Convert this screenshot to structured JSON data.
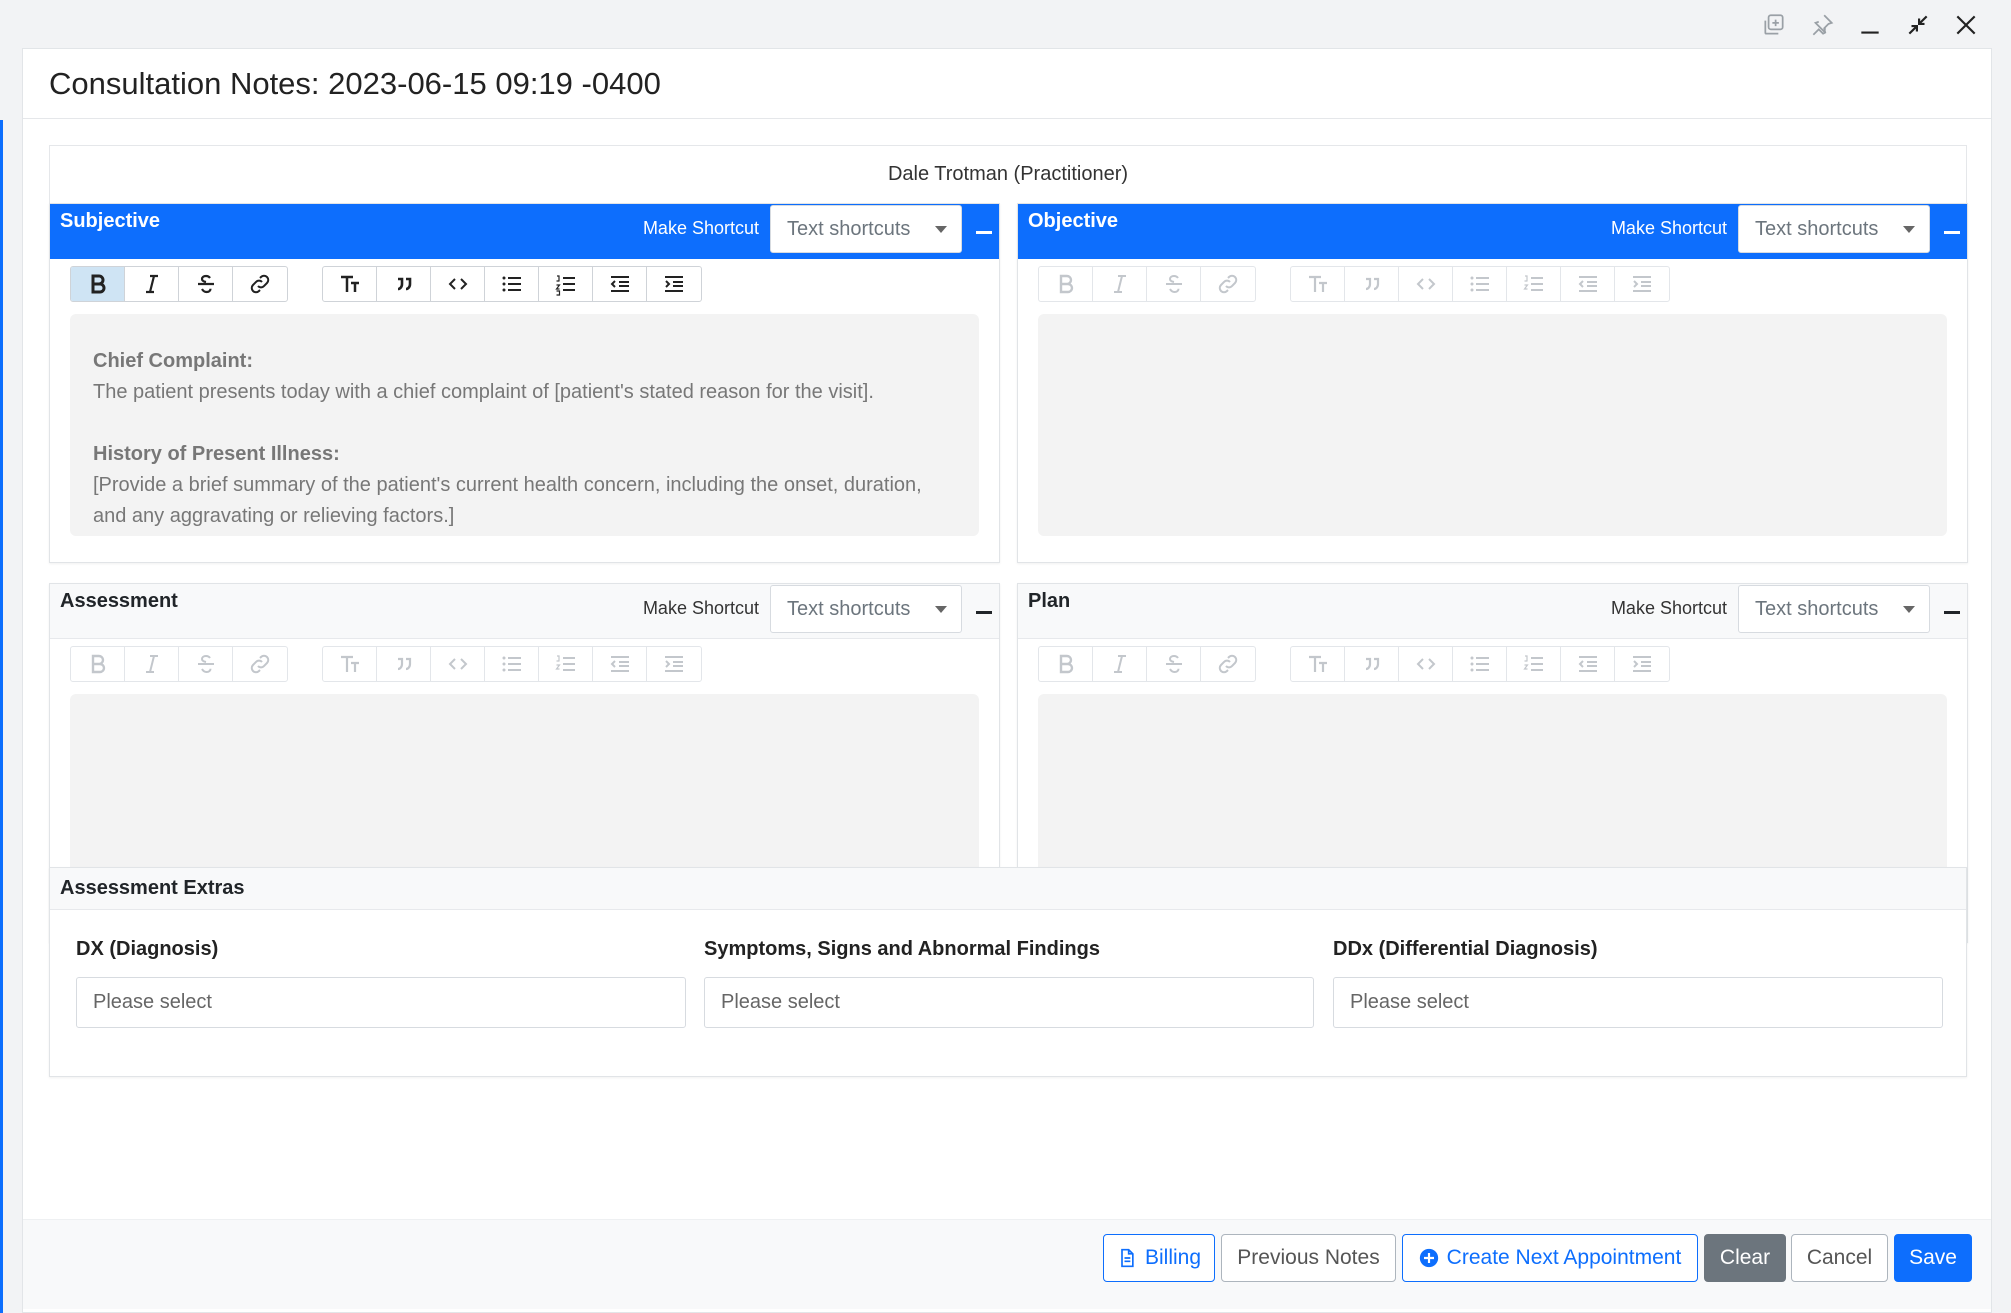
{
  "window_controls": [
    "restore-icon",
    "pin-icon",
    "minimize-icon",
    "collapse-icon",
    "close-icon"
  ],
  "modal": {
    "title": "Consultation Notes: 2023-06-15 09:19 -0400",
    "practitioner": "Dale Trotman (Practitioner)"
  },
  "panels": {
    "subjective": {
      "title": "Subjective",
      "make_shortcut": "Make Shortcut",
      "shortcut_placeholder": "Text shortcuts",
      "content": {
        "chief_complaint_heading": "Chief Complaint:",
        "chief_complaint_text": "The patient presents today with a chief complaint of [patient's stated reason for the visit].",
        "hpi_heading": "History of Present Illness:",
        "hpi_text": "[Provide a brief summary of the patient's current health concern, including the onset, duration, and any aggravating or relieving factors.]"
      }
    },
    "objective": {
      "title": "Objective",
      "make_shortcut": "Make Shortcut",
      "shortcut_placeholder": "Text shortcuts"
    },
    "assessment": {
      "title": "Assessment",
      "make_shortcut": "Make Shortcut",
      "shortcut_placeholder": "Text shortcuts"
    },
    "plan": {
      "title": "Plan",
      "make_shortcut": "Make Shortcut",
      "shortcut_placeholder": "Text shortcuts"
    }
  },
  "toolbar_icons": [
    "bold-icon",
    "italic-icon",
    "strikethrough-icon",
    "link-icon",
    "heading-icon",
    "quote-icon",
    "code-icon",
    "bullet-list-icon",
    "numbered-list-icon",
    "outdent-icon",
    "indent-icon"
  ],
  "extras": {
    "title": "Assessment Extras",
    "dx_label": "DX (Diagnosis)",
    "dx_placeholder": "Please select",
    "symptoms_label": "Symptoms, Signs and Abnormal Findings",
    "symptoms_placeholder": "Please select",
    "ddx_label": "DDx (Differential Diagnosis)",
    "ddx_placeholder": "Please select"
  },
  "footer": {
    "billing": "Billing",
    "previous_notes": "Previous Notes",
    "create_next": "Create Next Appointment",
    "clear": "Clear",
    "cancel": "Cancel",
    "save": "Save"
  },
  "colors": {
    "primary": "#0d6efd",
    "secondary": "#6c757d",
    "editor_bg": "#f3f3f3"
  }
}
